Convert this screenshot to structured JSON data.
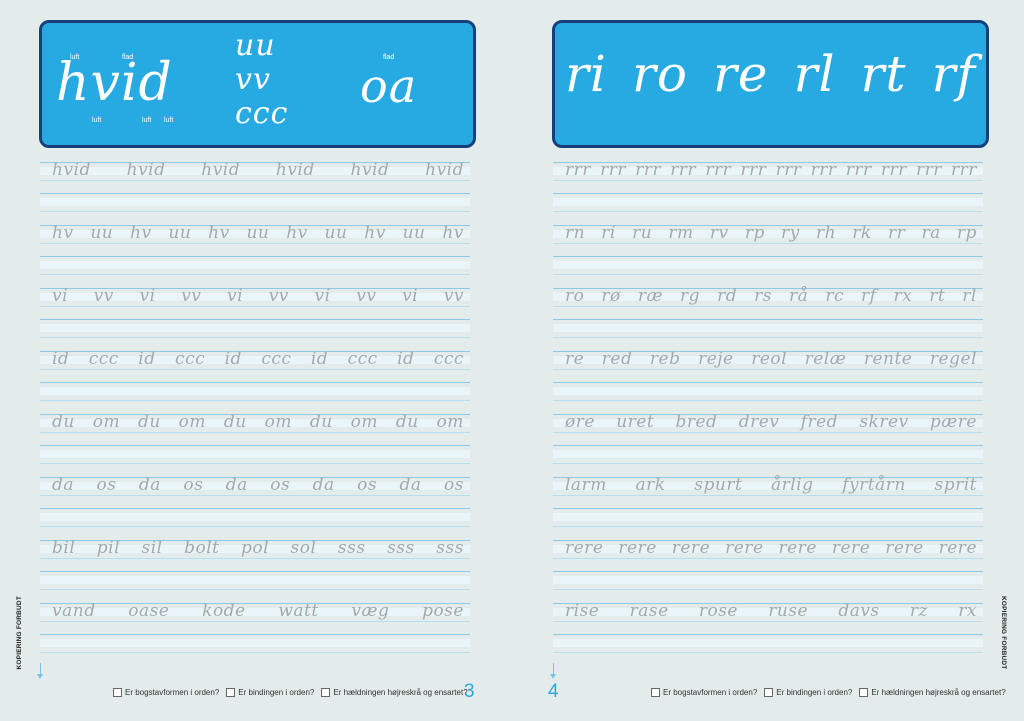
{
  "left": {
    "header": {
      "word": "hvid",
      "stacked": [
        "uu",
        "vv",
        "ccc"
      ],
      "oa": "oa",
      "annotations": {
        "luft_top": "luft",
        "flad_top": "flad",
        "luft_b1": "luft",
        "luft_b2": "luft",
        "luft_b3": "luft",
        "flad_oa": "flad"
      }
    },
    "rows": [
      [
        "hvid",
        "hvid",
        "hvid",
        "hvid",
        "hvid",
        "hvid"
      ],
      [
        "hv",
        "uu",
        "hv",
        "uu",
        "hv",
        "uu",
        "hv",
        "uu",
        "hv",
        "uu",
        "hv"
      ],
      [
        "vi",
        "vv",
        "vi",
        "vv",
        "vi",
        "vv",
        "vi",
        "vv",
        "vi",
        "vv"
      ],
      [
        "id",
        "ccc",
        "id",
        "ccc",
        "id",
        "ccc",
        "id",
        "ccc",
        "id",
        "ccc"
      ],
      [
        "du",
        "om",
        "du",
        "om",
        "du",
        "om",
        "du",
        "om",
        "du",
        "om"
      ],
      [
        "da",
        "os",
        "da",
        "os",
        "da",
        "os",
        "da",
        "os",
        "da",
        "os"
      ],
      [
        "bil",
        "pil",
        "sil",
        "bolt",
        "pol",
        "sol",
        "sss",
        "sss",
        "sss"
      ],
      [
        "vand",
        "oase",
        "kode",
        "watt",
        "væg",
        "pose"
      ]
    ],
    "footer": [
      "Er bogstavformen i orden?",
      "Er bindingen i orden?",
      "Er hældningen højreskrå og ensartet?"
    ],
    "page_number": "3",
    "side_text": "KOPIERING FORBUDT"
  },
  "right": {
    "header": {
      "pairs": [
        "ri",
        "ro",
        "re",
        "rl",
        "rt",
        "rf"
      ]
    },
    "rows": [
      [
        "rrr",
        "rrr",
        "rrr",
        "rrr",
        "rrr",
        "rrr",
        "rrr",
        "rrr",
        "rrr",
        "rrr",
        "rrr",
        "rrr"
      ],
      [
        "rn",
        "ri",
        "ru",
        "rm",
        "rv",
        "rp",
        "ry",
        "rh",
        "rk",
        "rr",
        "ra",
        "rp"
      ],
      [
        "ro",
        "rø",
        "ræ",
        "rg",
        "rd",
        "rs",
        "rå",
        "rc",
        "rf",
        "rx",
        "rt",
        "rl"
      ],
      [
        "re",
        "red",
        "reb",
        "reje",
        "reol",
        "relæ",
        "rente",
        "regel"
      ],
      [
        "øre",
        "uret",
        "bred",
        "drev",
        "fred",
        "skrev",
        "pære"
      ],
      [
        "larm",
        "ark",
        "spurt",
        "årlig",
        "fyrtårn",
        "sprit"
      ],
      [
        "rere",
        "rere",
        "rere",
        "rere",
        "rere",
        "rere",
        "rere",
        "rere"
      ],
      [
        "rise",
        "rase",
        "rose",
        "ruse",
        "davs",
        "rz",
        "rx"
      ]
    ],
    "footer": [
      "Er bogstavformen i orden?",
      "Er bindingen i orden?",
      "Er hældningen højreskrå og ensartet?"
    ],
    "page_number": "4",
    "side_text": "KOPIERING FORBUDT"
  },
  "colors": {
    "header_fill": "#27aae1",
    "header_border": "#17407a",
    "guide_line": "#8ec9e6",
    "trace_text": "#a3a9ad",
    "page_number": "#27aae1",
    "background": "#e3ecea"
  }
}
